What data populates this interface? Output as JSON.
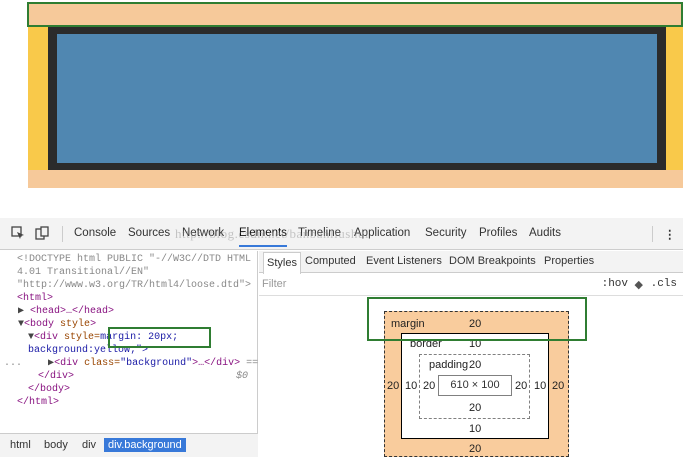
{
  "devtools": {
    "tabs": [
      "Console",
      "Sources",
      "Network",
      "Elements",
      "Timeline",
      "Application",
      "Security",
      "Profiles",
      "Audits"
    ],
    "active_tab": "Elements",
    "more_menu": "⋮",
    "watermark": "http://blog.csdn.net/banbanliushui"
  },
  "elements": {
    "doctype_1": "<!DOCTYPE html PUBLIC \"-//W3C//DTD HTML",
    "doctype_2": "4.01 Transitional//EN\"",
    "doctype_3": "\"http://www.w3.org/TR/html4/loose.dtd\">",
    "html_open": "<html>",
    "head": "<head>…</head>",
    "body_tag": "<body",
    "body_attr": "style",
    "body_close": ">",
    "div_tag": "<div",
    "div_attr": "style=",
    "div_margin": "margin: 20px;",
    "div_bg": "background:yellow;\">",
    "bg_div_open": "<div",
    "bg_div_attr": "class=",
    "bg_div_val": "\"background\"",
    "bg_div_rest": ">…</div>",
    "bg_div_eq": "==",
    "dollar0": "$0",
    "close_div": "</div>",
    "close_body": "</body>",
    "close_html": "</html>",
    "ellipsis": "..."
  },
  "breadcrumbs": [
    "html",
    "body",
    "div",
    "div.background"
  ],
  "styles": {
    "tabs": [
      "Styles",
      "Computed",
      "Event Listeners",
      "DOM Breakpoints",
      "Properties"
    ],
    "filter_placeholder": "Filter",
    "hov": ":hov",
    "cls": ".cls",
    "box_model": {
      "margin_label": "margin",
      "margin_top": "20",
      "margin_left": "20",
      "margin_right": "20",
      "margin_bottom": "20",
      "border_label": "border",
      "border_top": "10",
      "border_left": "10",
      "border_right": "10",
      "border_bottom": "10",
      "padding_label": "padding",
      "padding_top": "20",
      "padding_left": "20",
      "padding_right": "20",
      "padding_bottom": "20",
      "content": "610 × 100"
    }
  },
  "colors": {
    "page_yellow": "#f9c94a",
    "margin_orange": "#f6c99a",
    "border_dark": "#2b2b2b",
    "content_blue": "#5087b1",
    "highlight_green": "#2f7d32",
    "selection_blue": "#3879d9"
  }
}
